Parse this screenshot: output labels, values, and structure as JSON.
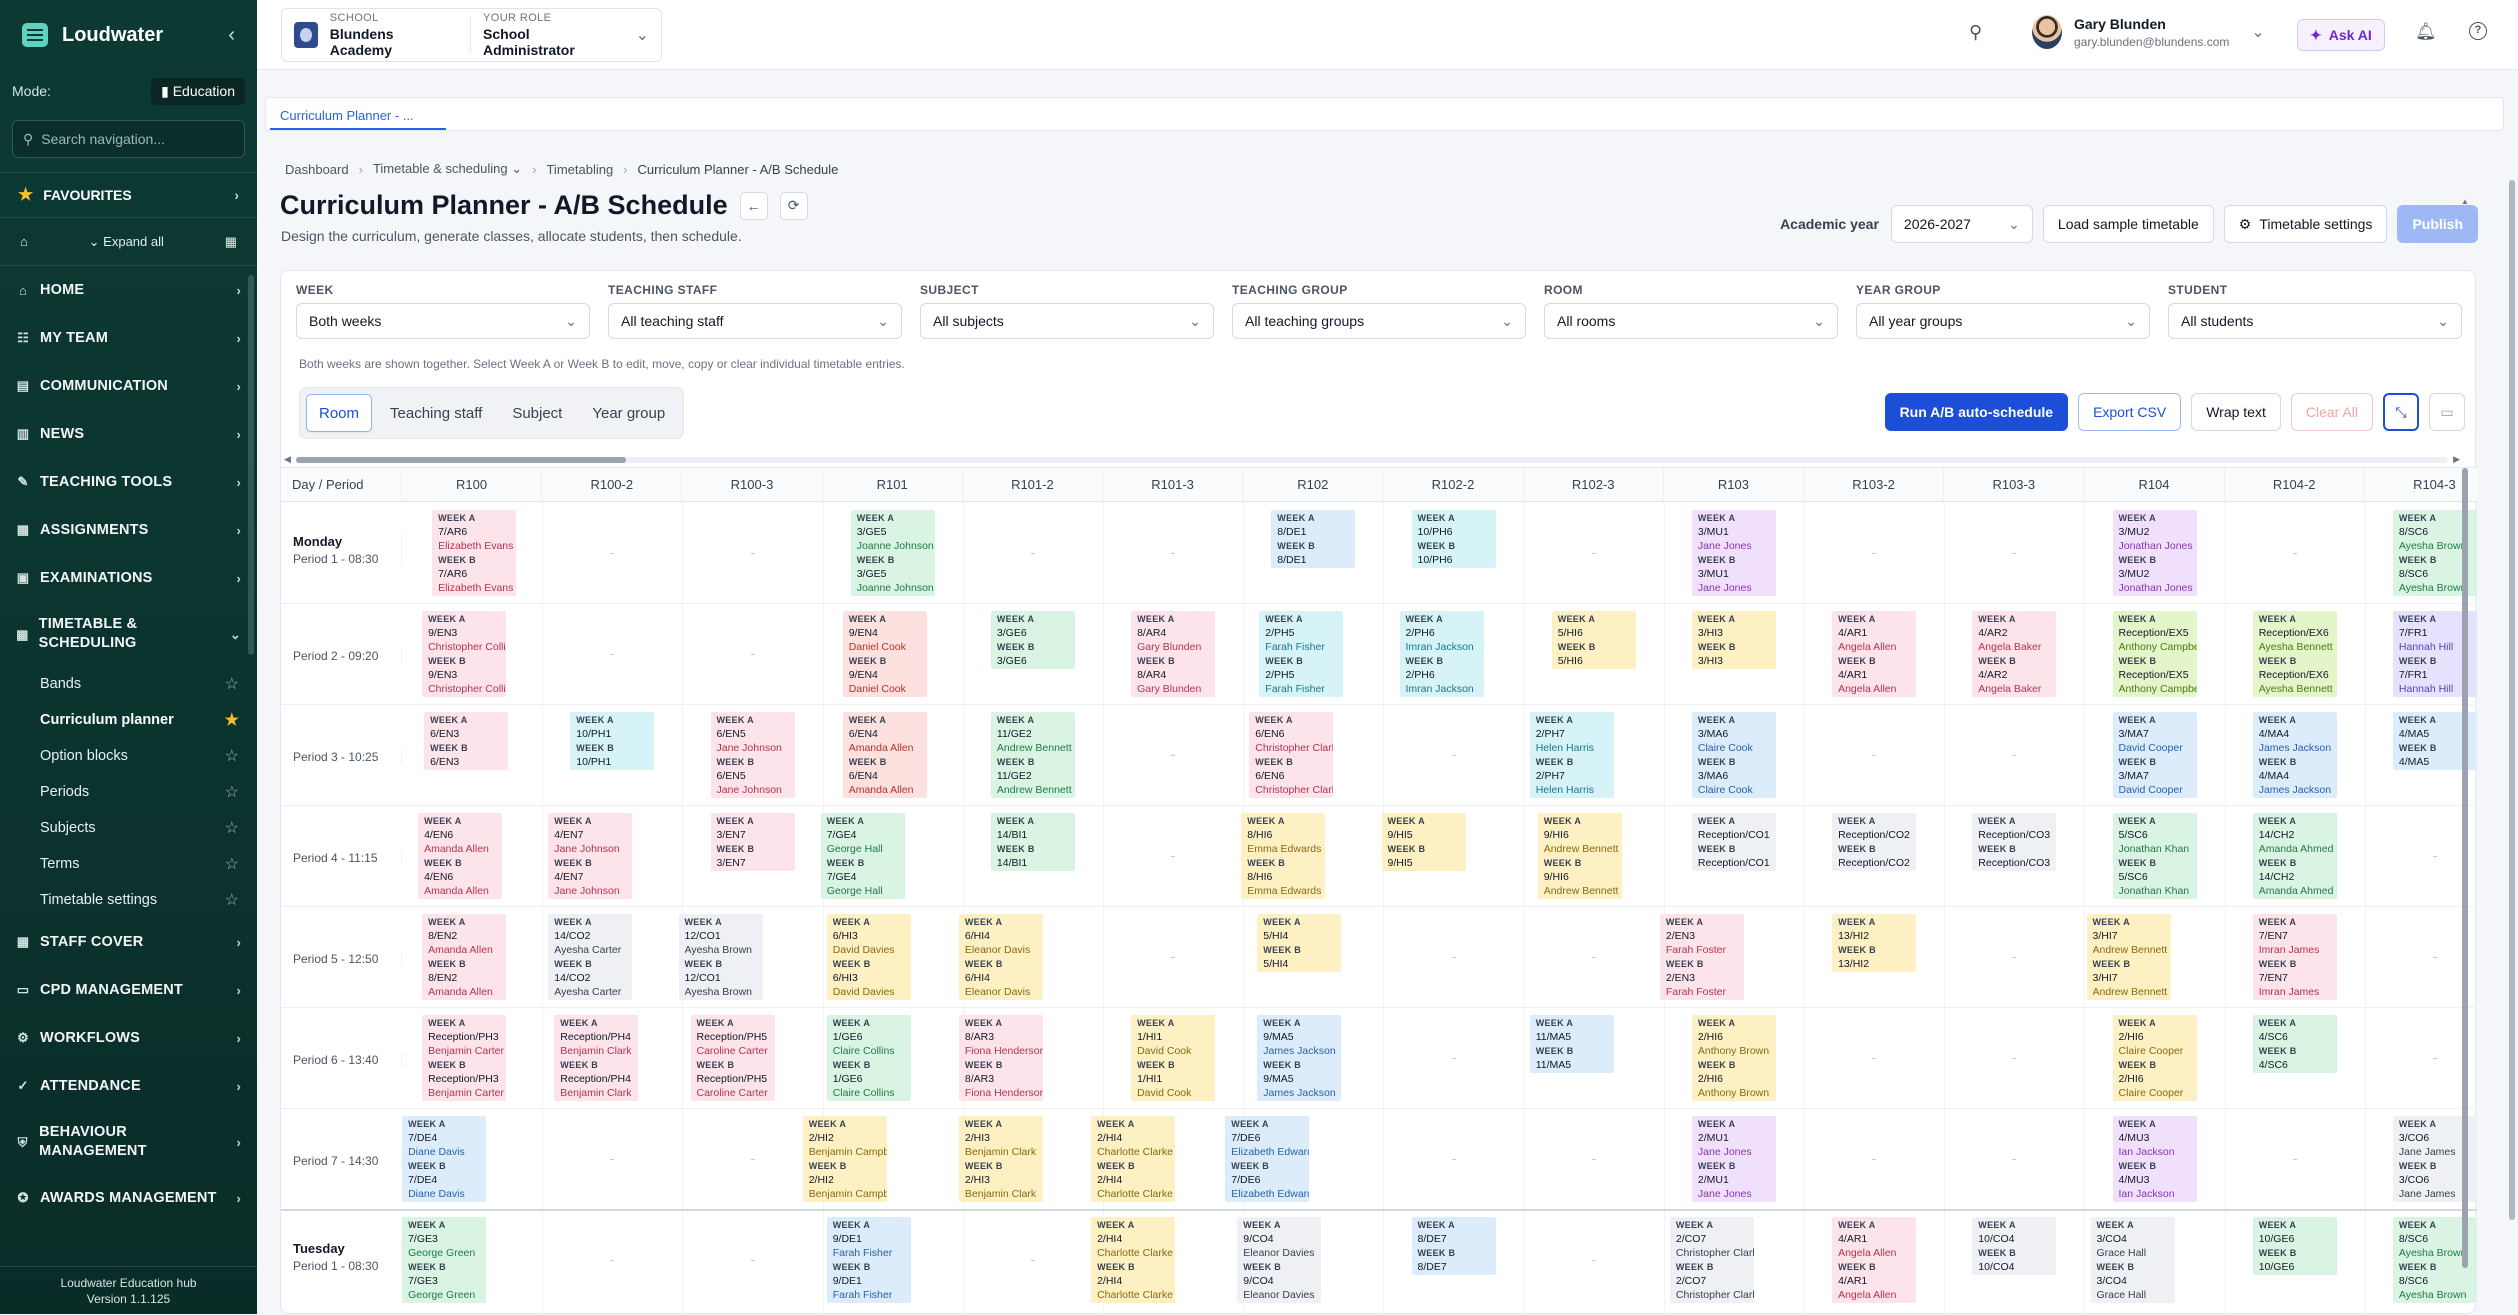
{
  "sidebar": {
    "brand": "Loudwater",
    "collapse_icon": "chevron-left-icon",
    "mode_label": "Mode:",
    "mode_value": "Education",
    "search_placeholder": "Search navigation...",
    "favourites": "FAVOURITES",
    "expand_all": "Expand all",
    "items": [
      {
        "label": "HOME",
        "icon": "home-icon"
      },
      {
        "label": "MY TEAM",
        "icon": "team-icon"
      },
      {
        "label": "COMMUNICATION",
        "icon": "chat-icon"
      },
      {
        "label": "NEWS",
        "icon": "news-icon"
      },
      {
        "label": "TEACHING TOOLS",
        "icon": "pencil-icon"
      },
      {
        "label": "ASSIGNMENTS",
        "icon": "clipboard-icon"
      },
      {
        "label": "EXAMINATIONS",
        "icon": "exam-icon"
      },
      {
        "label": "TIMETABLE & SCHEDULING",
        "icon": "calendar-icon"
      }
    ],
    "subitems": [
      {
        "label": "Bands",
        "active": false
      },
      {
        "label": "Curriculum planner",
        "active": true
      },
      {
        "label": "Option blocks",
        "active": false
      },
      {
        "label": "Periods",
        "active": false
      },
      {
        "label": "Subjects",
        "active": false
      },
      {
        "label": "Terms",
        "active": false
      },
      {
        "label": "Timetable settings",
        "active": false
      }
    ],
    "items_after": [
      {
        "label": "STAFF COVER",
        "icon": "cover-icon"
      },
      {
        "label": "CPD MANAGEMENT",
        "icon": "cpd-icon"
      },
      {
        "label": "WORKFLOWS",
        "icon": "workflow-icon"
      },
      {
        "label": "ATTENDANCE",
        "icon": "check-icon"
      },
      {
        "label": "BEHAVIOUR MANAGEMENT",
        "icon": "shield-icon"
      },
      {
        "label": "AWARDS MANAGEMENT",
        "icon": "award-icon"
      }
    ],
    "footer_line1": "Loudwater Education hub",
    "footer_line2": "Version 1.1.125"
  },
  "topbar": {
    "school_label": "SCHOOL",
    "school_value": "Blundens Academy",
    "role_label": "YOUR ROLE",
    "role_value": "School Administrator",
    "user_name": "Gary Blunden",
    "user_email": "gary.blunden@blundens.com",
    "ask_ai": "Ask AI"
  },
  "tab": "Curriculum Planner - ...",
  "breadcrumb": [
    "Dashboard",
    "Timetable & scheduling",
    "Timetabling",
    "Curriculum Planner - A/B Schedule"
  ],
  "page": {
    "title": "Curriculum Planner - A/B Schedule",
    "subtitle": "Design the curriculum, generate classes, allocate students, then schedule.",
    "academic_year_label": "Academic year",
    "academic_year": "2026-2027",
    "load_sample": "Load sample timetable",
    "timetable_settings": "Timetable settings",
    "publish": "Publish"
  },
  "filters": [
    {
      "label": "WEEK",
      "value": "Both weeks"
    },
    {
      "label": "TEACHING STAFF",
      "value": "All teaching staff"
    },
    {
      "label": "SUBJECT",
      "value": "All subjects"
    },
    {
      "label": "TEACHING GROUP",
      "value": "All teaching groups"
    },
    {
      "label": "ROOM",
      "value": "All rooms"
    },
    {
      "label": "YEAR GROUP",
      "value": "All year groups"
    },
    {
      "label": "STUDENT",
      "value": "All students"
    }
  ],
  "hint": "Both weeks are shown together. Select Week A or Week B to edit, move, copy or clear individual timetable entries.",
  "views": [
    "Room",
    "Teaching staff",
    "Subject",
    "Year group"
  ],
  "active_view": "Room",
  "actions": {
    "run": "Run A/B auto-schedule",
    "export": "Export CSV",
    "wrap": "Wrap text",
    "clear": "Clear All"
  },
  "grid": {
    "corner": "Day / Period",
    "columns": [
      "R100",
      "R100-2",
      "R100-3",
      "R101",
      "R101-2",
      "R101-3",
      "R102",
      "R102-2",
      "R102-3",
      "R103",
      "R103-2",
      "R103-3",
      "R104",
      "R104-2",
      "R104-3"
    ],
    "week_a": "WEEK A",
    "week_b": "WEEK B",
    "rows": [
      {
        "day": "Monday",
        "period": "Period 1 - 08:30",
        "cells": [
          {
            "c": 0,
            "g": "7/AR6",
            "t": "Elizabeth Evans",
            "k": "pink",
            "o": 2
          },
          {
            "c": 3,
            "g": "3/GE5",
            "t": "Joanne Johnson",
            "k": "green",
            "o": 0
          },
          {
            "c": 6,
            "g": "8/DE1",
            "t": "",
            "k": "blue",
            "o": 0
          },
          {
            "c": 7,
            "g": "10/PH6",
            "t": "",
            "k": "cyan",
            "o": 0
          },
          {
            "c": 9,
            "g": "3/MU1",
            "t": "Jane Jones",
            "k": "purple",
            "o": 0
          },
          {
            "c": 12,
            "g": "3/MU2",
            "t": "Jonathan Jones",
            "k": "purple",
            "o": 0
          },
          {
            "c": 14,
            "g": "8/SC6",
            "t": "Ayesha Brown",
            "k": "green",
            "o": 0
          }
        ]
      },
      {
        "day": "",
        "period": "Period 2 - 09:20",
        "cells": [
          {
            "c": 0,
            "g": "9/EN3",
            "t": "Christopher Collins",
            "k": "pink",
            "o": -8
          },
          {
            "c": 3,
            "g": "9/EN4",
            "t": "Daniel Cook",
            "k": "red",
            "o": -8
          },
          {
            "c": 4,
            "g": "3/GE6",
            "t": "",
            "k": "green",
            "o": 0
          },
          {
            "c": 5,
            "g": "8/AR4",
            "t": "Gary Blunden",
            "k": "pink",
            "o": 0
          },
          {
            "c": 6,
            "g": "2/PH5",
            "t": "Farah Fisher",
            "k": "cyan",
            "o": -12
          },
          {
            "c": 7,
            "g": "2/PH6",
            "t": "Imran Jackson",
            "k": "cyan",
            "o": -12
          },
          {
            "c": 8,
            "g": "5/HI6",
            "t": "",
            "k": "yellow",
            "o": 0
          },
          {
            "c": 9,
            "g": "3/HI3",
            "t": "",
            "k": "yellow",
            "o": 0
          },
          {
            "c": 10,
            "g": "4/AR1",
            "t": "Angela Allen",
            "k": "pink",
            "o": 0
          },
          {
            "c": 11,
            "g": "4/AR2",
            "t": "Angela Baker",
            "k": "pink",
            "o": 0
          },
          {
            "c": 12,
            "g": "Reception/EX5",
            "t": "Anthony Campbell",
            "k": "lime",
            "o": 0
          },
          {
            "c": 13,
            "g": "Reception/EX6",
            "t": "Ayesha Bennett",
            "k": "lime",
            "o": 0
          },
          {
            "c": 14,
            "g": "7/FR1",
            "t": "Hannah Hill",
            "k": "violet",
            "o": 0
          }
        ]
      },
      {
        "day": "",
        "period": "Period 3 - 10:25",
        "cells": [
          {
            "c": 0,
            "g": "6/EN3",
            "t": "",
            "k": "pink",
            "o": -6
          },
          {
            "c": 1,
            "g": "10/PH1",
            "t": "",
            "k": "cyan",
            "o": 0
          },
          {
            "c": 2,
            "g": "6/EN5",
            "t": "Jane Johnson",
            "k": "pink",
            "o": 0
          },
          {
            "c": 3,
            "g": "6/EN4",
            "t": "Amanda Allen",
            "k": "red",
            "o": -8
          },
          {
            "c": 4,
            "g": "11/GE2",
            "t": "Andrew Bennett",
            "k": "green",
            "o": 0
          },
          {
            "c": 6,
            "g": "6/EN6",
            "t": "Christopher Clark",
            "k": "pink",
            "o": -22
          },
          {
            "c": 8,
            "g": "2/PH7",
            "t": "Helen Harris",
            "k": "cyan",
            "o": -22
          },
          {
            "c": 9,
            "g": "3/MA6",
            "t": "Claire Cook",
            "k": "blue",
            "o": 0
          },
          {
            "c": 12,
            "g": "3/MA7",
            "t": "David Cooper",
            "k": "blue",
            "o": 0
          },
          {
            "c": 13,
            "g": "4/MA4",
            "t": "James Jackson",
            "k": "blue",
            "o": 0
          },
          {
            "c": 14,
            "g": "4/MA5",
            "t": "",
            "k": "blue",
            "o": 0
          }
        ]
      },
      {
        "day": "",
        "period": "Period 4 - 11:15",
        "cells": [
          {
            "c": 0,
            "g": "4/EN6",
            "t": "Amanda Allen",
            "k": "pink",
            "o": -12
          },
          {
            "c": 1,
            "g": "4/EN7",
            "t": "Jane Johnson",
            "k": "pink",
            "o": -22
          },
          {
            "c": 2,
            "g": "3/EN7",
            "t": "",
            "k": "pink",
            "o": 0
          },
          {
            "c": 3,
            "g": "7/GE4",
            "t": "George Hall",
            "k": "green",
            "o": -30
          },
          {
            "c": 4,
            "g": "14/BI1",
            "t": "",
            "k": "green",
            "o": 0
          },
          {
            "c": 6,
            "g": "8/HI6",
            "t": "Emma Edwards",
            "k": "yellow",
            "o": -30
          },
          {
            "c": 7,
            "g": "9/HI5",
            "t": "",
            "k": "yellow",
            "o": -30
          },
          {
            "c": 8,
            "g": "9/HI6",
            "t": "Andrew Bennett",
            "k": "yellow",
            "o": -14
          },
          {
            "c": 9,
            "g": "Reception/CO1",
            "t": "",
            "k": "gray",
            "o": 0
          },
          {
            "c": 10,
            "g": "Reception/CO2",
            "t": "",
            "k": "gray",
            "o": 0
          },
          {
            "c": 11,
            "g": "Reception/CO3",
            "t": "",
            "k": "gray",
            "o": 0
          },
          {
            "c": 12,
            "g": "5/SC6",
            "t": "Jonathan Khan",
            "k": "green",
            "o": 0
          },
          {
            "c": 13,
            "g": "14/CH2",
            "t": "Amanda Ahmed",
            "k": "green",
            "o": 0
          }
        ]
      },
      {
        "day": "",
        "period": "Period 5 - 12:50",
        "cells": [
          {
            "c": 0,
            "g": "8/EN2",
            "t": "Amanda Allen",
            "k": "pink",
            "o": -8
          },
          {
            "c": 1,
            "g": "14/CO2",
            "t": "Ayesha Carter",
            "k": "gray",
            "o": -22
          },
          {
            "c": 2,
            "g": "12/CO1",
            "t": "Ayesha Brown",
            "k": "gray",
            "o": -32
          },
          {
            "c": 3,
            "g": "6/HI3",
            "t": "David Davies",
            "k": "yellow",
            "o": -24
          },
          {
            "c": 4,
            "g": "6/HI4",
            "t": "Eleanor Davis",
            "k": "yellow",
            "o": -32
          },
          {
            "c": 6,
            "g": "5/HI4",
            "t": "",
            "k": "yellow",
            "o": -14
          },
          {
            "c": 9,
            "g": "2/EN3",
            "t": "Farah Foster",
            "k": "pink",
            "o": -32
          },
          {
            "c": 10,
            "g": "13/HI2",
            "t": "",
            "k": "yellow",
            "o": 0
          },
          {
            "c": 12,
            "g": "3/HI7",
            "t": "Andrew Bennett",
            "k": "yellow",
            "o": -26
          },
          {
            "c": 13,
            "g": "7/EN7",
            "t": "Imran James",
            "k": "pink",
            "o": 0
          }
        ]
      },
      {
        "day": "",
        "period": "Period 6 - 13:40",
        "cells": [
          {
            "c": 0,
            "g": "Reception/PH3",
            "t": "Benjamin Carter",
            "k": "pink",
            "o": -8
          },
          {
            "c": 1,
            "g": "Reception/PH4",
            "t": "Benjamin Clark",
            "k": "pink",
            "o": -16
          },
          {
            "c": 2,
            "g": "Reception/PH5",
            "t": "Caroline Carter",
            "k": "pink",
            "o": -20
          },
          {
            "c": 3,
            "g": "1/GE6",
            "t": "Claire Collins",
            "k": "green",
            "o": -24
          },
          {
            "c": 4,
            "g": "8/AR3",
            "t": "Fiona Henderson",
            "k": "pink",
            "o": -32
          },
          {
            "c": 5,
            "g": "1/HI1",
            "t": "David Cook",
            "k": "yellow",
            "o": 0
          },
          {
            "c": 6,
            "g": "9/MA5",
            "t": "James Jackson",
            "k": "blue",
            "o": -14
          },
          {
            "c": 8,
            "g": "11/MA5",
            "t": "",
            "k": "blue",
            "o": -22
          },
          {
            "c": 9,
            "g": "2/HI6",
            "t": "Anthony Brown",
            "k": "yellow",
            "o": 0
          },
          {
            "c": 12,
            "g": "2/HI6",
            "t": "Claire Cooper",
            "k": "yellow",
            "o": 0
          },
          {
            "c": 13,
            "g": "4/SC6",
            "t": "",
            "k": "green",
            "o": 0
          }
        ]
      },
      {
        "day": "",
        "period": "Period 7 - 14:30",
        "cells": [
          {
            "c": 0,
            "g": "7/DE4",
            "t": "Diane Davis",
            "k": "blue",
            "o": -28
          },
          {
            "c": 3,
            "g": "2/HI2",
            "t": "Benjamin Campbell",
            "k": "yellow",
            "o": -48
          },
          {
            "c": 4,
            "g": "2/HI3",
            "t": "Benjamin Clark",
            "k": "yellow",
            "o": -32
          },
          {
            "c": 5,
            "g": "2/HI4",
            "t": "Charlotte Clarke",
            "k": "yellow",
            "o": -40
          },
          {
            "c": 6,
            "g": "7/DE6",
            "t": "Elizabeth Edwards",
            "k": "blue",
            "o": -46
          },
          {
            "c": 9,
            "g": "2/MU1",
            "t": "Jane Jones",
            "k": "purple",
            "o": 0
          },
          {
            "c": 12,
            "g": "4/MU3",
            "t": "Ian Jackson",
            "k": "purple",
            "o": 0
          },
          {
            "c": 14,
            "g": "3/CO6",
            "t": "Jane James",
            "k": "gray",
            "o": 0
          }
        ]
      },
      {
        "day": "Tuesday",
        "period": "Period 1 - 08:30",
        "cells": [
          {
            "c": 0,
            "g": "7/GE3",
            "t": "George Green",
            "k": "green",
            "o": -28
          },
          {
            "c": 3,
            "g": "9/DE1",
            "t": "Farah Fisher",
            "k": "blue",
            "o": -24
          },
          {
            "c": 5,
            "g": "2/HI4",
            "t": "Charlotte Clarke",
            "k": "yellow",
            "o": -40
          },
          {
            "c": 6,
            "g": "9/CO4",
            "t": "Eleanor Davies",
            "k": "gray",
            "o": -34
          },
          {
            "c": 7,
            "g": "8/DE7",
            "t": "",
            "k": "blue",
            "o": 0
          },
          {
            "c": 9,
            "g": "2/CO7",
            "t": "Christopher Clarke",
            "k": "gray",
            "o": -22
          },
          {
            "c": 10,
            "g": "4/AR1",
            "t": "Angela Allen",
            "k": "pink",
            "o": 0
          },
          {
            "c": 11,
            "g": "10/CO4",
            "t": "",
            "k": "gray",
            "o": 0
          },
          {
            "c": 12,
            "g": "3/CO4",
            "t": "Grace Hall",
            "k": "gray",
            "o": -22
          },
          {
            "c": 13,
            "g": "10/GE6",
            "t": "",
            "k": "green",
            "o": 0
          },
          {
            "c": 14,
            "g": "8/SC6",
            "t": "Ayesha Brown",
            "k": "green",
            "o": 0
          }
        ]
      }
    ]
  }
}
